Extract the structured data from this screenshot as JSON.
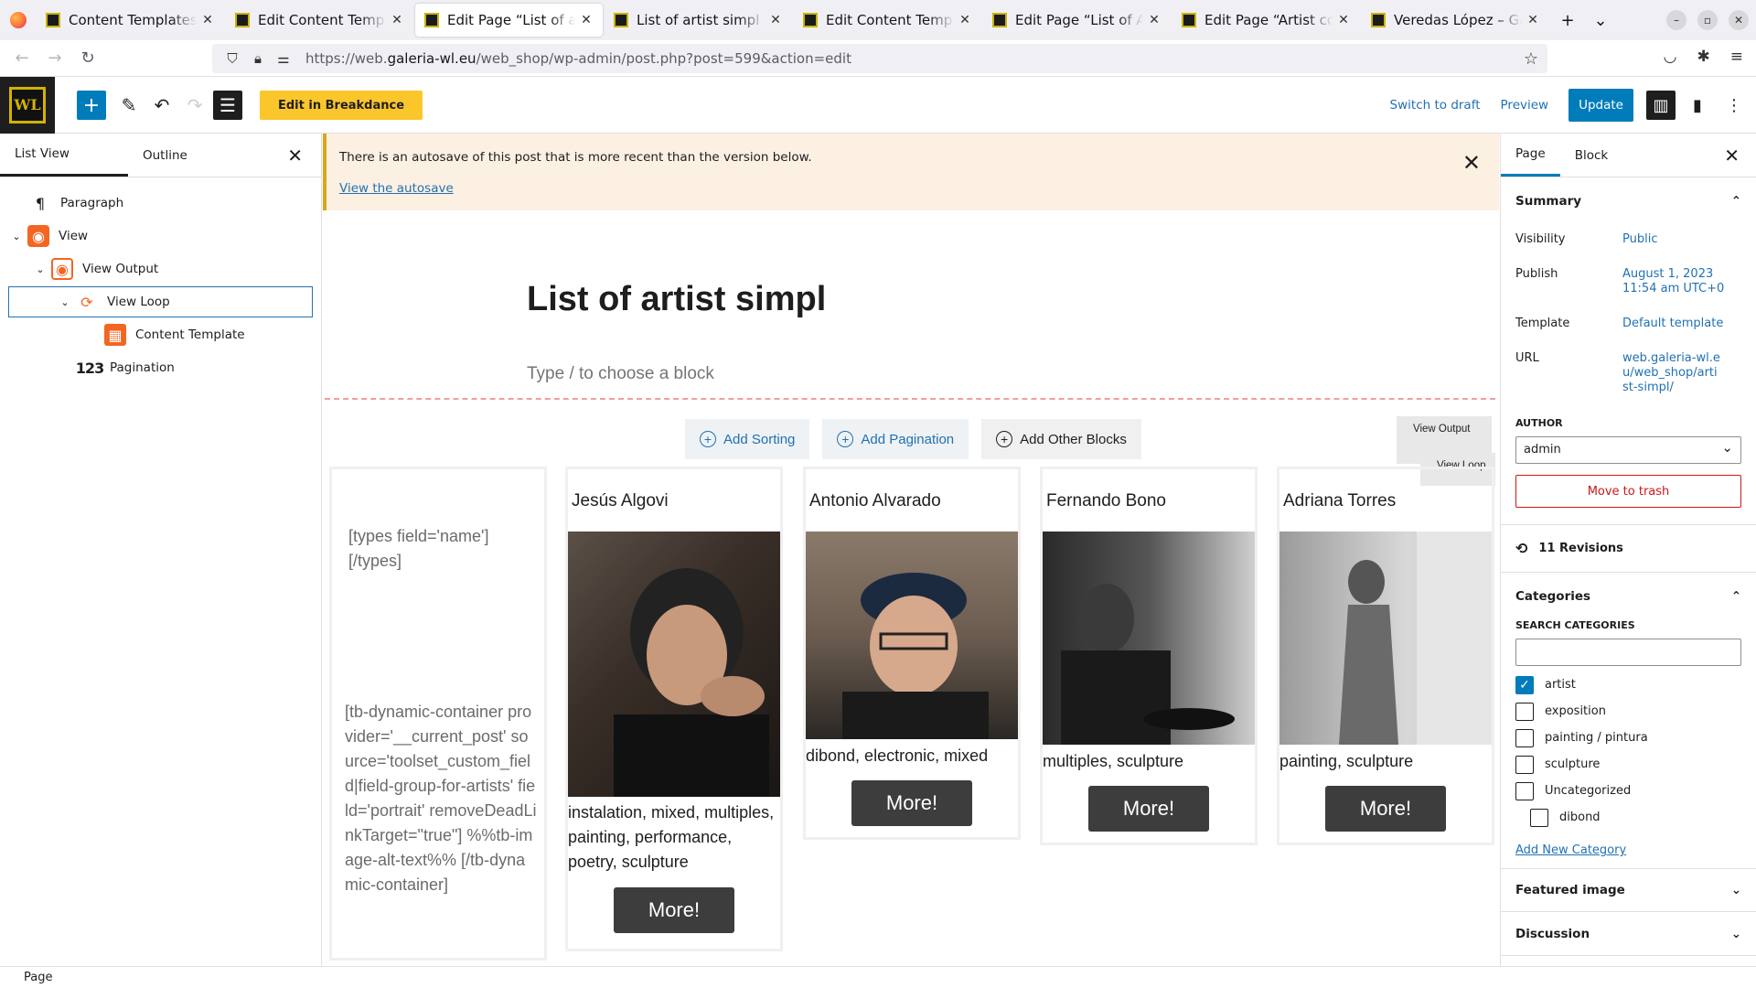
{
  "browser": {
    "tabs": [
      {
        "title": "Content Templates ‹ Galeria"
      },
      {
        "title": "Edit Content Template"
      },
      {
        "title": "Edit Page “List of artist simpl”"
      },
      {
        "title": "List of artist simpl – Galeria"
      },
      {
        "title": "Edit Content Template"
      },
      {
        "title": "Edit Page “List of Artists”"
      },
      {
        "title": "Edit Page “Artist complete”"
      },
      {
        "title": "Veredas López – Galeria"
      }
    ],
    "url_prefix": "https://web.",
    "url_domain": "galeria-wl.eu",
    "url_suffix": "/web_shop/wp-admin/post.php?post=599&action=edit"
  },
  "toolbar": {
    "logo_text": "WL",
    "breakdance_label": "Edit in Breakdance",
    "switch_draft": "Switch to draft",
    "preview": "Preview",
    "update": "Update"
  },
  "left_panel": {
    "tab_list": "List View",
    "tab_outline": "Outline",
    "items": [
      {
        "label": "Paragraph"
      },
      {
        "label": "View"
      },
      {
        "label": "View Output"
      },
      {
        "label": "View Loop"
      },
      {
        "label": "Content Template"
      },
      {
        "label": "Pagination"
      }
    ],
    "pagination_icon": "123"
  },
  "notice": {
    "message": "There is an autosave of this post that is more recent than the version below.",
    "link": "View the autosave"
  },
  "editor": {
    "title": "List of artist simpl",
    "appender": "Type / to choose a block",
    "add_sorting": "Add Sorting",
    "add_pagination": "Add Pagination",
    "add_other": "Add Other Blocks",
    "view_output_label": "View Output",
    "view_loop_label": "View Loop",
    "template_shortcode_name": "[types field='name'] [/types]",
    "template_shortcode_image": "[tb-dynamic-container provider='__current_post' source='toolset_custom_field|field-group-for-artists' field='portrait' removeDeadLinkTarget=\"true\"] %%tb-image-alt-text%% [/tb-dynamic-container]",
    "cards": [
      {
        "name": "Jesús Algovi",
        "tags": "instalation, mixed, multiples, painting, performance, poetry, sculpture",
        "button": "More!"
      },
      {
        "name": "Antonio Alvarado",
        "tags": "dibond, electronic, mixed",
        "button": "More!"
      },
      {
        "name": "Fernando Bono",
        "tags": "multiples, sculpture",
        "button": "More!"
      },
      {
        "name": "Adriana Torres",
        "tags": "painting, sculpture",
        "button": "More!"
      }
    ]
  },
  "right_panel": {
    "tab_page": "Page",
    "tab_block": "Block",
    "summary": "Summary",
    "visibility_label": "Visibility",
    "visibility_value": "Public",
    "publish_label": "Publish",
    "publish_value": "August 1, 2023 11:54 am UTC+0",
    "template_label": "Template",
    "template_value": "Default template",
    "url_label": "URL",
    "url_value": "web.galeria-wl.eu/web_shop/artist-simpl/",
    "author_label": "AUTHOR",
    "author_value": "admin",
    "trash": "Move to trash",
    "revisions": "11 Revisions",
    "categories": "Categories",
    "search_label": "SEARCH CATEGORIES",
    "category_items": [
      {
        "label": "artist",
        "checked": true
      },
      {
        "label": "exposition",
        "checked": false
      },
      {
        "label": "painting / pintura",
        "checked": false
      },
      {
        "label": "sculpture",
        "checked": false
      },
      {
        "label": "Uncategorized",
        "checked": false
      },
      {
        "label": "dibond",
        "checked": false
      }
    ],
    "add_category": "Add New Category",
    "featured_image": "Featured image",
    "discussion": "Discussion"
  },
  "status_bar": {
    "label": "Page"
  },
  "colors": {
    "accent": "#007cba",
    "breakdance": "#fbc62b",
    "toolset_orange": "#f26622",
    "danger": "#cc1818"
  }
}
